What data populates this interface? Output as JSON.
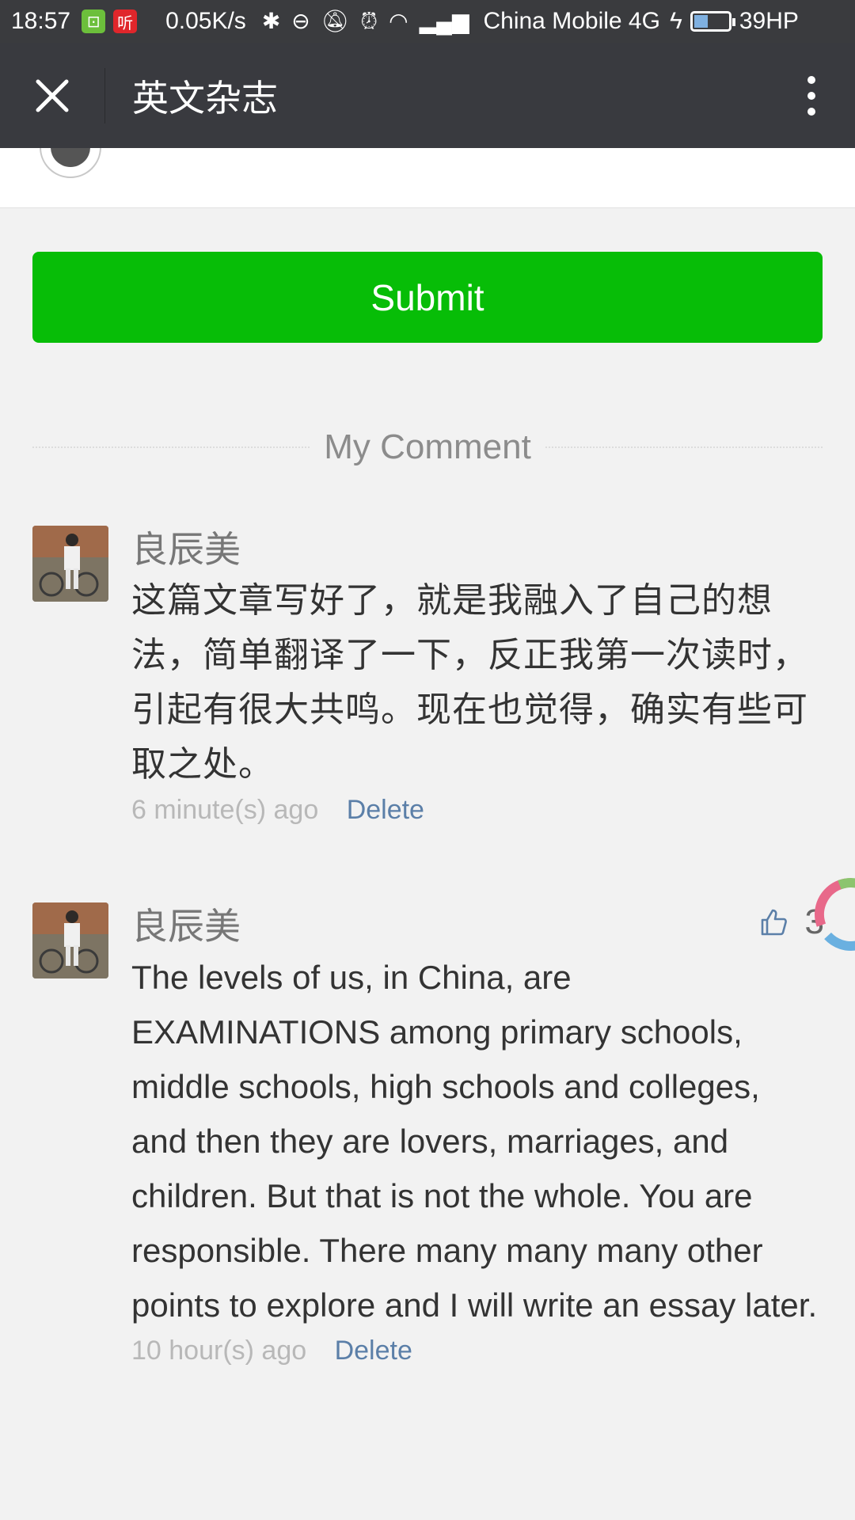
{
  "status_bar": {
    "time": "18:57",
    "badge_green": "⊡",
    "badge_red": "听",
    "speed": "0.05K/s",
    "carrier": "China Mobile 4G",
    "battery_level": 0.39,
    "battery_text": "39HP"
  },
  "header": {
    "title": "英文杂志"
  },
  "form": {
    "submit_label": "Submit"
  },
  "comments_section": {
    "title": "My Comment",
    "comments": [
      {
        "author": "良辰美",
        "text": "这篇文章写好了，就是我融入了自己的想法，简单翻译了一下，反正我第一次读时，引起有很大共鸣。现在也觉得，确实有些可取之处。",
        "time": "6 minute(s) ago",
        "delete_label": "Delete"
      },
      {
        "author": "良辰美",
        "text": "The levels of us, in China, are EXAMINATIONS among primary schools, middle schools, high schools and colleges, and then they are lovers, marriages, and children. But that is not the whole. You are responsible. There many many many other points to explore and I will write an essay later.",
        "time": "10 hour(s) ago",
        "delete_label": "Delete",
        "likes": "3"
      }
    ]
  },
  "colors": {
    "status_bar_bg": "#3a3b3e",
    "title_bar_bg": "#393a3f",
    "submit_green": "#07bd07",
    "delete_link": "#5b7fa8",
    "page_bg": "#f2f2f2"
  },
  "icons": {
    "close": "close-icon",
    "more": "more-vertical-icon",
    "like": "thumbs-up-icon"
  }
}
